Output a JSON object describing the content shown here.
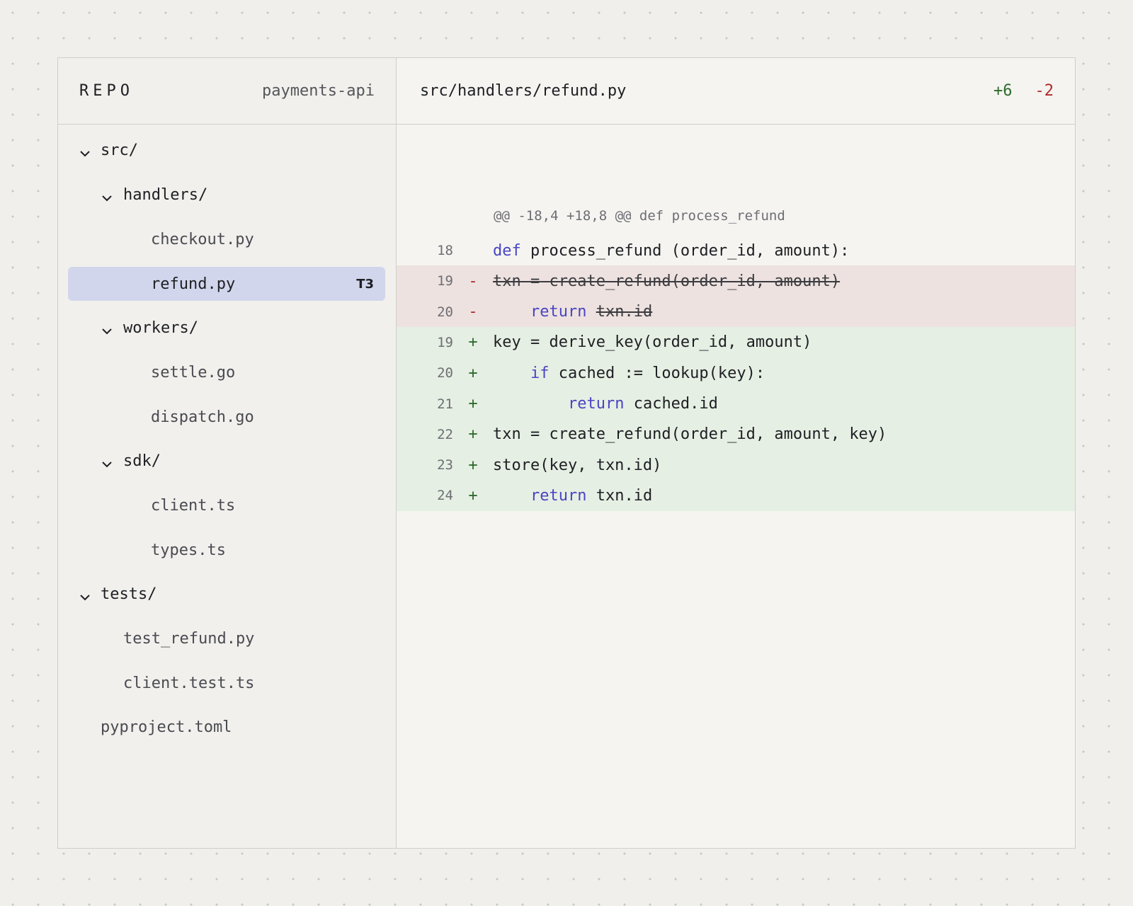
{
  "sidebar": {
    "repo_label": "REPO",
    "repo_name": "payments-api",
    "tree": [
      {
        "label": "src/",
        "type": "folder"
      },
      {
        "label": "handlers/",
        "type": "folder"
      },
      {
        "label": "checkout.py",
        "type": "file"
      },
      {
        "label": "refund.py",
        "type": "file",
        "selected": true,
        "badge": "T3"
      },
      {
        "label": "workers/",
        "type": "folder"
      },
      {
        "label": "settle.go",
        "type": "file"
      },
      {
        "label": "dispatch.go",
        "type": "file"
      },
      {
        "label": "sdk/",
        "type": "folder"
      },
      {
        "label": "client.ts",
        "type": "file"
      },
      {
        "label": "types.ts",
        "type": "file"
      },
      {
        "label": "tests/",
        "type": "folder"
      },
      {
        "label": "test_refund.py",
        "type": "file"
      },
      {
        "label": "client.test.ts",
        "type": "file"
      },
      {
        "label": "pyproject.toml",
        "type": "file"
      }
    ]
  },
  "editor": {
    "file_path": "src/handlers/refund.py",
    "added": "+6",
    "removed": "-2",
    "hunk_header": "@@ -18,4 +18,8 @@ def process_refund",
    "lines": [
      {
        "num": "18",
        "marker": "",
        "kind": "ctx",
        "indent": "",
        "keyword": "def",
        "text": "process_refund (order_id, amount):"
      },
      {
        "num": "19",
        "marker": "-",
        "kind": "del",
        "indent": "",
        "keyword": "",
        "text": "txn = create_refund(order_id, amount)"
      },
      {
        "num": "20",
        "marker": "-",
        "kind": "del",
        "indent": "    ",
        "keyword": "return",
        "text": "txn.id"
      },
      {
        "num": "19",
        "marker": "+",
        "kind": "add",
        "indent": "",
        "keyword": "",
        "text": "key = derive_key(order_id, amount)"
      },
      {
        "num": "20",
        "marker": "+",
        "kind": "add",
        "indent": "    ",
        "keyword": "if",
        "text": "cached := lookup(key):"
      },
      {
        "num": "21",
        "marker": "+",
        "kind": "add",
        "indent": "        ",
        "keyword": "return",
        "text": "cached.id"
      },
      {
        "num": "22",
        "marker": "+",
        "kind": "add",
        "indent": "",
        "keyword": "",
        "text": "txn = create_refund(order_id, amount, key)"
      },
      {
        "num": "23",
        "marker": "+",
        "kind": "add",
        "indent": "",
        "keyword": "",
        "text": "store(key, txn.id)"
      },
      {
        "num": "24",
        "marker": "+",
        "kind": "add",
        "indent": "    ",
        "keyword": "return",
        "text": "txn.id"
      }
    ]
  }
}
